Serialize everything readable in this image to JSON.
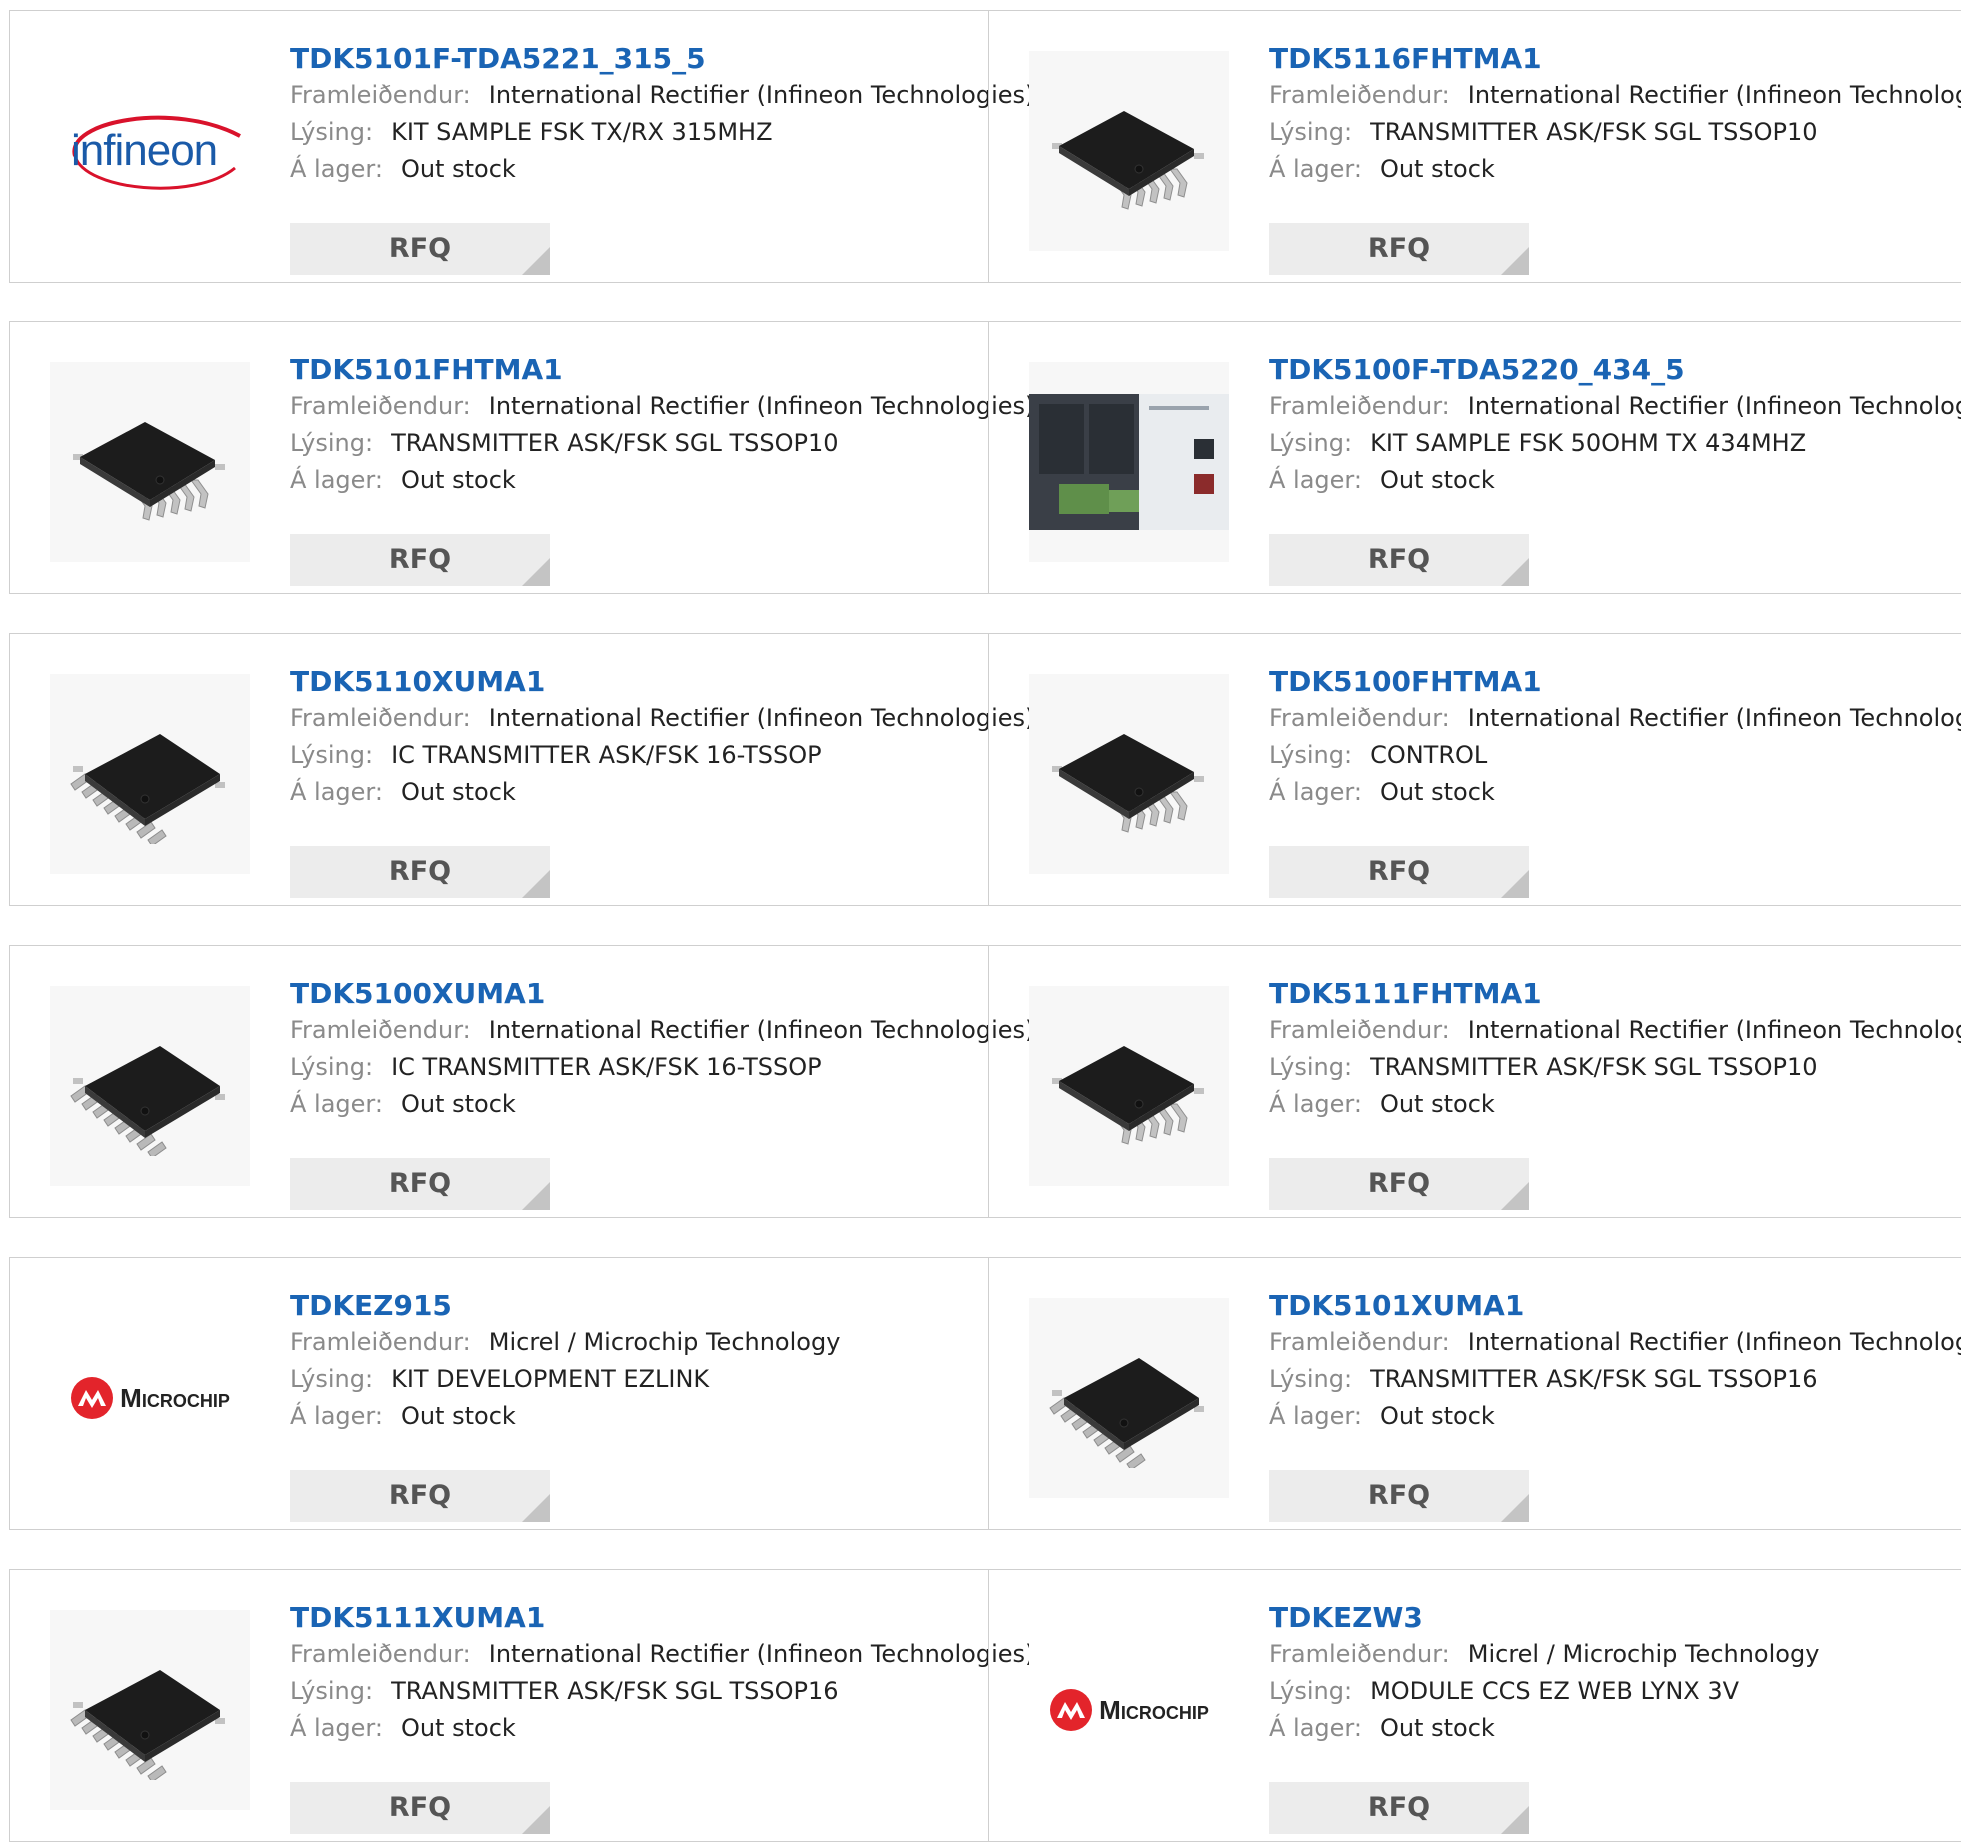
{
  "labels": {
    "manufacturer": "Framleiðendur:",
    "description": "Lýsing:",
    "stock": "Á lager:",
    "rfq": "RFQ"
  },
  "logos": {
    "infineon": "infineon",
    "microchip": "Microchip"
  },
  "products": [
    {
      "part": "TDK5101F-TDA5221_315_5",
      "manufacturer": "International Rectifier (Infineon Technologies)",
      "description": "KIT SAMPLE FSK TX/RX 315MHZ",
      "stock": "Out stock",
      "image": "infineon-logo"
    },
    {
      "part": "TDK5116FHTMA1",
      "manufacturer": "International Rectifier (Infineon Technologies)",
      "description": "TRANSMITTER ASK/FSK SGL TSSOP10",
      "stock": "Out stock",
      "image": "chip-10"
    },
    {
      "part": "TDK5101FHTMA1",
      "manufacturer": "International Rectifier (Infineon Technologies)",
      "description": "TRANSMITTER ASK/FSK SGL TSSOP10",
      "stock": "Out stock",
      "image": "chip-10"
    },
    {
      "part": "TDK5100F-TDA5220_434_5",
      "manufacturer": "International Rectifier (Infineon Technologies)",
      "description": "KIT SAMPLE FSK 50OHM TX 434MHZ",
      "stock": "Out stock",
      "image": "kit-photo"
    },
    {
      "part": "TDK5110XUMA1",
      "manufacturer": "International Rectifier (Infineon Technologies)",
      "description": "IC TRANSMITTER ASK/FSK 16-TSSOP",
      "stock": "Out stock",
      "image": "chip-16"
    },
    {
      "part": "TDK5100FHTMA1",
      "manufacturer": "International Rectifier (Infineon Technologies)",
      "description": "CONTROL",
      "stock": "Out stock",
      "image": "chip-10"
    },
    {
      "part": "TDK5100XUMA1",
      "manufacturer": "International Rectifier (Infineon Technologies)",
      "description": "IC TRANSMITTER ASK/FSK 16-TSSOP",
      "stock": "Out stock",
      "image": "chip-16"
    },
    {
      "part": "TDK5111FHTMA1",
      "manufacturer": "International Rectifier (Infineon Technologies)",
      "description": "TRANSMITTER ASK/FSK SGL TSSOP10",
      "stock": "Out stock",
      "image": "chip-10"
    },
    {
      "part": "TDKEZ915",
      "manufacturer": "Micrel / Microchip Technology",
      "description": "KIT DEVELOPMENT EZLINK",
      "stock": "Out stock",
      "image": "microchip-logo"
    },
    {
      "part": "TDK5101XUMA1",
      "manufacturer": "International Rectifier (Infineon Technologies)",
      "description": "TRANSMITTER ASK/FSK SGL TSSOP16",
      "stock": "Out stock",
      "image": "chip-16"
    },
    {
      "part": "TDK5111XUMA1",
      "manufacturer": "International Rectifier (Infineon Technologies)",
      "description": "TRANSMITTER ASK/FSK SGL TSSOP16",
      "stock": "Out stock",
      "image": "chip-16"
    },
    {
      "part": "TDKEZW3",
      "manufacturer": "Micrel / Microchip Technology",
      "description": "MODULE CCS EZ WEB LYNX 3V",
      "stock": "Out stock",
      "image": "microchip-logo"
    }
  ]
}
